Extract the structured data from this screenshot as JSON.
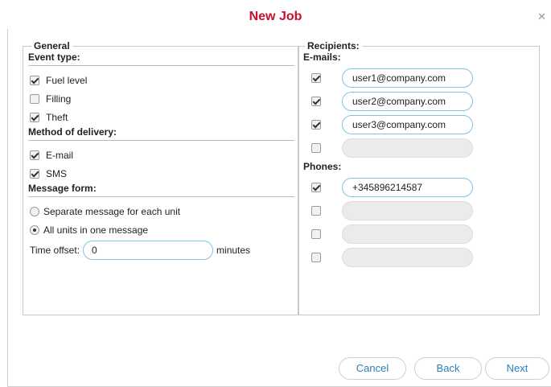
{
  "dialog": {
    "title": "New Job"
  },
  "general": {
    "legend": "General",
    "event_type": {
      "heading": "Event type:",
      "items": [
        {
          "label": "Fuel level",
          "checked": true
        },
        {
          "label": "Filling",
          "checked": false
        },
        {
          "label": "Theft",
          "checked": true
        }
      ]
    },
    "delivery": {
      "heading": "Method of delivery:",
      "items": [
        {
          "label": "E-mail",
          "checked": true
        },
        {
          "label": "SMS",
          "checked": true
        }
      ]
    },
    "message_form": {
      "heading": "Message form:",
      "options": [
        {
          "label": "Separate message for each unit",
          "selected": false
        },
        {
          "label": "All units in one message",
          "selected": true
        }
      ]
    },
    "time_offset": {
      "label": "Time offset:",
      "value": "0",
      "unit": "minutes"
    }
  },
  "recipients": {
    "legend": "Recipients:",
    "emails": {
      "heading": "E-mails:",
      "items": [
        {
          "value": "user1@company.com",
          "checked": true
        },
        {
          "value": "user2@company.com",
          "checked": true
        },
        {
          "value": "user3@company.com",
          "checked": true
        },
        {
          "value": "",
          "checked": false
        }
      ]
    },
    "phones": {
      "heading": "Phones:",
      "items": [
        {
          "value": "+345896214587",
          "checked": true
        },
        {
          "value": "",
          "checked": false
        },
        {
          "value": "",
          "checked": false
        },
        {
          "value": "",
          "checked": false
        }
      ]
    }
  },
  "buttons": {
    "cancel": "Cancel",
    "back": "Back",
    "next": "Next"
  },
  "icons": {
    "close": "close-icon",
    "checkbox": "checkbox-icon",
    "radio": "radio-icon"
  },
  "colors": {
    "title": "#c8102e",
    "input_border": "#7cc3e8",
    "button_text": "#2a7fb8"
  }
}
